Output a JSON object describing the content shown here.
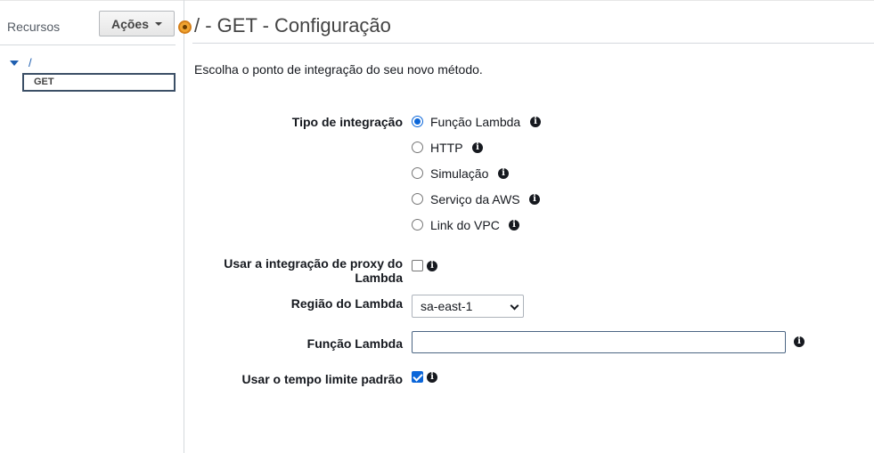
{
  "sidebar": {
    "title": "Recursos",
    "actions_label": "Ações",
    "tree": {
      "root": "/",
      "child": "GET"
    }
  },
  "main": {
    "title": "/ - GET - Configuração",
    "intro": "Escolha o ponto de integração do seu novo método.",
    "integration_type": {
      "label": "Tipo de integração",
      "selected": "Função Lambda",
      "options": [
        "Função Lambda",
        "HTTP",
        "Simulação",
        "Serviço da AWS",
        "Link do VPC"
      ]
    },
    "proxy": {
      "label": "Usar a integração de proxy do Lambda",
      "checked": false
    },
    "region": {
      "label": "Região do Lambda",
      "value": "sa-east-1"
    },
    "lambda_function": {
      "label": "Função Lambda",
      "value": ""
    },
    "default_timeout": {
      "label": "Usar o tempo limite padrão",
      "checked": true
    }
  },
  "colors": {
    "accent": "#0b66d9",
    "link": "#1f5fb0",
    "dot": "#f0a431"
  },
  "icons": {
    "info": "info-icon",
    "tree_toggle": "triangle-down-icon",
    "dropdown": "chevron-down-icon"
  }
}
